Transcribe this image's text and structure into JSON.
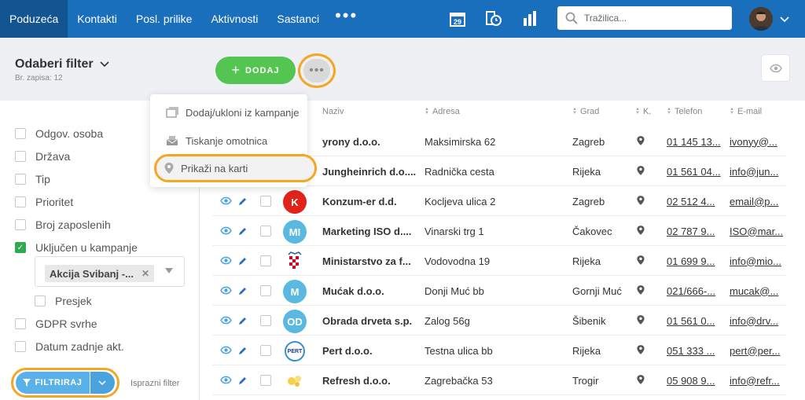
{
  "nav": {
    "items": [
      "Poduzeća",
      "Kontakti",
      "Posl. prilike",
      "Aktivnosti",
      "Sastanci"
    ],
    "more": "•••",
    "calendar_day": "29",
    "search_placeholder": "Tražilica..."
  },
  "header": {
    "filter_title": "Odaberi filter",
    "record_count": "Br. zapisa: 12",
    "add_button": "DODAJ"
  },
  "dropdown": {
    "items": [
      "Dodaj/ukloni iz kampanje",
      "Tiskanje omotnica",
      "Prikaži na karti"
    ]
  },
  "sidebar": {
    "filters": [
      {
        "label": "Odgov. osoba",
        "checked": false
      },
      {
        "label": "Država",
        "checked": false
      },
      {
        "label": "Tip",
        "checked": false
      },
      {
        "label": "Prioritet",
        "checked": false
      },
      {
        "label": "Broj zaposlenih",
        "checked": false
      },
      {
        "label": "Uključen u kampanje",
        "checked": true
      }
    ],
    "campaign_tag": "Akcija Svibanj -...",
    "presjek": "Presjek",
    "filters_after": [
      {
        "label": "GDPR svrhe",
        "checked": false
      },
      {
        "label": "Datum zadnje akt.",
        "checked": false
      }
    ],
    "filter_button": "FILTRIRAJ",
    "clear_filter": "Isprazni filter"
  },
  "table": {
    "columns": [
      "Naziv",
      "Adresa",
      "Grad",
      "K.",
      "Telefon",
      "E-mail"
    ],
    "rows": [
      {
        "name": "yrony d.o.o.",
        "address": "Maksimirska 62",
        "city": "Zagreb",
        "phone": "01 145 13...",
        "email": "ivonyy@..."
      },
      {
        "name": "Jungheinrich d.o....",
        "address": "Radnička cesta",
        "city": "Rijeka",
        "phone": "01 561 04...",
        "email": "info@jun..."
      },
      {
        "name": "Konzum-er d.d.",
        "address": "Kocljeva ulica 2",
        "city": "Zagreb",
        "phone": "02 512 4...",
        "email": "email@p..."
      },
      {
        "name": "Marketing ISO d....",
        "address": "Vinarski trg 1",
        "city": "Čakovec",
        "phone": "02 787 9...",
        "email": "ISO@mar..."
      },
      {
        "name": "Ministarstvo za f...",
        "address": "Vodovodna 19",
        "city": "Rijeka",
        "phone": "01 699 9...",
        "email": "info@mio..."
      },
      {
        "name": "Mućak d.o.o.",
        "address": "Donji Muć bb",
        "city": "Gornji Muć",
        "phone": "021/666-...",
        "email": "mucak@..."
      },
      {
        "name": "Obrada drveta s.p.",
        "address": "Zalog 56g",
        "city": "Šibenik",
        "phone": "01 561 0...",
        "email": "info@drv..."
      },
      {
        "name": "Pert d.o.o.",
        "address": "Testna ulica bb",
        "city": "Rijeka",
        "phone": "051 333 ...",
        "email": "pert@per..."
      },
      {
        "name": "Refresh d.o.o.",
        "address": "Zagrebačka 53",
        "city": "Trogir",
        "phone": "05 908 9...",
        "email": "info@refr..."
      }
    ],
    "logos": [
      {
        "text": "",
        "color": "#ffffff"
      },
      {
        "text": "",
        "color": "#ffffff"
      },
      {
        "text": "K",
        "color": "#e2231a"
      },
      {
        "text": "MI",
        "color": "#5bb8e0"
      },
      {
        "text": "",
        "color": "#ffffff"
      },
      {
        "text": "M",
        "color": "#5bb8e0"
      },
      {
        "text": "OD",
        "color": "#5bb8e0"
      },
      {
        "text": "PERT",
        "color": "#ffffff"
      },
      {
        "text": "",
        "color": "#ffffff"
      }
    ]
  },
  "colors": {
    "nav_bg": "#1a6fbd",
    "highlight": "#f5a623",
    "add_green": "#55c552",
    "filter_blue": "#5ab0e8"
  }
}
